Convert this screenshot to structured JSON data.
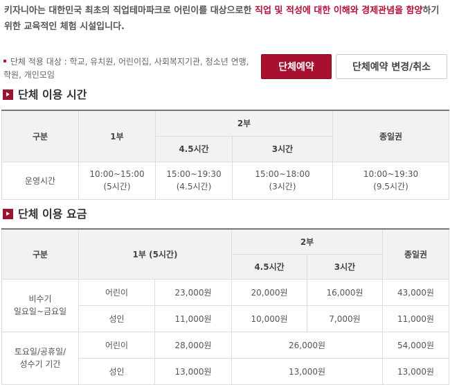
{
  "intro": {
    "text_before": "키자니아는 대한민국 최초의 직업테마파크로  어린이를 대상으로한 ",
    "highlight": "직업 및 적성에 대한 이해와 경제관념을 함양",
    "text_after": "하기 위한 교육적인 체험 시설입니다."
  },
  "group_target": "단체 적용 대상 : 학교, 유치원, 어린이집, 사회복지기관, 청소년 연맹, 학원, 개인모임",
  "buttons": {
    "reserve": "단체예약",
    "change_cancel": "단체예약 변경/취소"
  },
  "accent_color": "#a8102f",
  "time_section": {
    "title": "단체 이용 시간",
    "headers": {
      "category": "구분",
      "part1": "1부",
      "part2": "2부",
      "part2_a": "4.5시간",
      "part2_b": "3시간",
      "allday": "종일권"
    },
    "row": {
      "label": "운영시간",
      "part1_time": "10:00~15:00",
      "part1_dur": "(5시간)",
      "part2a_time": "15:00~19:30",
      "part2a_dur": "(4.5시간)",
      "part2b_time": "15:00~18:00",
      "part2b_dur": "(3시간)",
      "allday_time": "10:00~19:30",
      "allday_dur": "(9.5시간)"
    }
  },
  "fee_section": {
    "title": "단체 이용 요금",
    "headers": {
      "category": "구분",
      "part1": "1부 (5시간)",
      "part2": "2부",
      "part2_a": "4.5시간",
      "part2_b": "3시간",
      "allday": "종일권"
    },
    "offpeak": {
      "label_line1": "비수기",
      "label_line2": "일요일~금요일",
      "child": {
        "label": "어린이",
        "part1": "23,000원",
        "part2a": "20,000원",
        "part2b": "16,000원",
        "allday": "43,000원"
      },
      "adult": {
        "label": "성인",
        "part1": "11,000원",
        "part2a": "10,000원",
        "part2b": "7,000원",
        "allday": "11,000원"
      }
    },
    "peak": {
      "label_line1": "토요일/공휴일/",
      "label_line2": "성수기 기간",
      "child": {
        "label": "어린이",
        "part1": "28,000원",
        "part2": "26,000원",
        "allday": "54,000원"
      },
      "adult": {
        "label": "성인",
        "part1": "13,000원",
        "part2": "13,000원",
        "allday": "13,000원"
      }
    }
  }
}
